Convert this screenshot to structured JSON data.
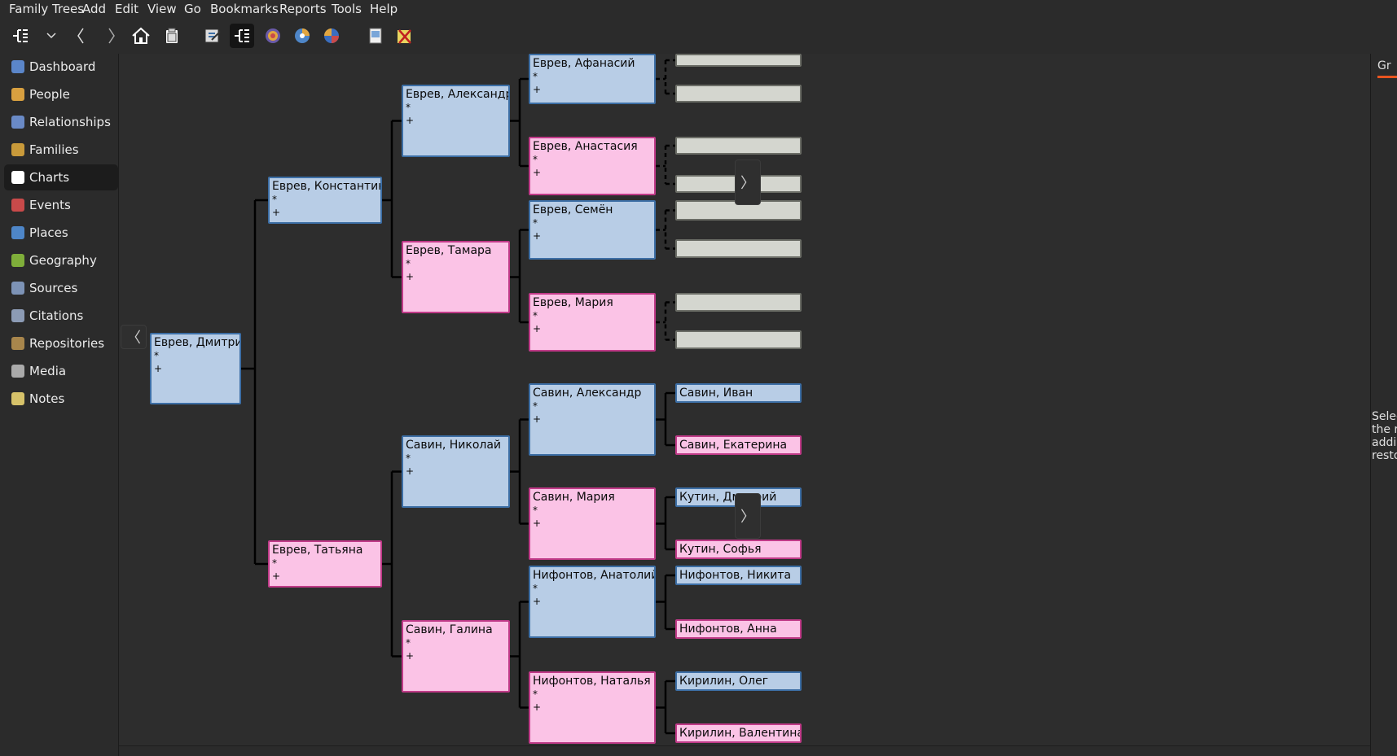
{
  "menu": [
    "Family Trees",
    "Add",
    "Edit",
    "View",
    "Go",
    "Bookmarks",
    "Reports",
    "Tools",
    "Help"
  ],
  "toolbar": {
    "buttons": [
      "pedigree-view-icon",
      "dropdown-chevron-icon",
      "back-icon",
      "forward-icon",
      "home-icon",
      "clipboard-icon",
      "edit-person-icon",
      "pedigree-active-icon",
      "fanchart-icon",
      "fanchart-descendant-icon",
      "fanchart-2way-icon",
      "media-icon",
      "tools-icon"
    ]
  },
  "sidebar": {
    "items": [
      {
        "label": "Dashboard",
        "icon": "dashboard-icon",
        "color": "#5b86c9"
      },
      {
        "label": "People",
        "icon": "people-icon",
        "color": "#d8a040"
      },
      {
        "label": "Relationships",
        "icon": "relationships-icon",
        "color": "#6a8ac6"
      },
      {
        "label": "Families",
        "icon": "families-icon",
        "color": "#c99a3a"
      },
      {
        "label": "Charts",
        "icon": "charts-icon",
        "color": "#ffffff"
      },
      {
        "label": "Events",
        "icon": "events-icon",
        "color": "#c94a4a"
      },
      {
        "label": "Places",
        "icon": "places-icon",
        "color": "#4e86c8"
      },
      {
        "label": "Geography",
        "icon": "geography-icon",
        "color": "#7fae3a"
      },
      {
        "label": "Sources",
        "icon": "sources-icon",
        "color": "#7d93b6"
      },
      {
        "label": "Citations",
        "icon": "citations-icon",
        "color": "#8c9bb5"
      },
      {
        "label": "Repositories",
        "icon": "repositories-icon",
        "color": "#a8864c"
      },
      {
        "label": "Media",
        "icon": "media-icon",
        "color": "#aaaaaa"
      },
      {
        "label": "Notes",
        "icon": "notes-icon",
        "color": "#d6c26a"
      }
    ],
    "active": "Charts"
  },
  "right_pane": {
    "tab": "Gr",
    "text": [
      "Selec",
      "the r",
      "addi",
      "resto"
    ]
  },
  "colors": {
    "male_fill": "#b8cde6",
    "female_fill": "#fbc3e6",
    "unknown_fill": "#d4d6cf",
    "background": "#2d2d2d"
  },
  "pedigree": [
    {
      "id": "p1",
      "name": "Еврев, Дмитрий",
      "gender": "male",
      "birth": "*",
      "death": "+"
    },
    {
      "id": "p2",
      "name": "Еврев, Константин",
      "gender": "male",
      "birth": "*",
      "death": "+"
    },
    {
      "id": "p3",
      "name": "Еврев, Татьяна",
      "gender": "female",
      "birth": "*",
      "death": "+"
    },
    {
      "id": "p4",
      "name": "Еврев, Александр",
      "gender": "male",
      "birth": "*",
      "death": "+"
    },
    {
      "id": "p5",
      "name": "Еврев, Тамара",
      "gender": "female",
      "birth": "*",
      "death": "+"
    },
    {
      "id": "p6",
      "name": "Савин, Николай",
      "gender": "male",
      "birth": "*",
      "death": "+"
    },
    {
      "id": "p7",
      "name": "Савин, Галина",
      "gender": "female",
      "birth": "*",
      "death": "+"
    },
    {
      "id": "p8",
      "name": "Еврев, Афанасий",
      "gender": "male",
      "birth": "*",
      "death": "+"
    },
    {
      "id": "p9",
      "name": "Еврев, Анастасия",
      "gender": "female",
      "birth": "*",
      "death": "+"
    },
    {
      "id": "p10",
      "name": "Еврев, Семён",
      "gender": "male",
      "birth": "*",
      "death": "+"
    },
    {
      "id": "p11",
      "name": "Еврев, Мария",
      "gender": "female",
      "birth": "*",
      "death": "+"
    },
    {
      "id": "p12",
      "name": "Савин, Александр",
      "gender": "male",
      "birth": "*",
      "death": "+"
    },
    {
      "id": "p13",
      "name": "Савин, Мария",
      "gender": "female",
      "birth": "*",
      "death": "+"
    },
    {
      "id": "p14",
      "name": "Нифонтов, Анатолий",
      "gender": "male",
      "birth": "*",
      "death": "+"
    },
    {
      "id": "p15",
      "name": "Нифонтов, Наталья",
      "gender": "female",
      "birth": "*",
      "death": "+"
    },
    {
      "id": "p16",
      "name": "",
      "gender": "unknown"
    },
    {
      "id": "p17",
      "name": "",
      "gender": "unknown"
    },
    {
      "id": "p18",
      "name": "",
      "gender": "unknown"
    },
    {
      "id": "p19",
      "name": "",
      "gender": "unknown"
    },
    {
      "id": "p20",
      "name": "",
      "gender": "unknown"
    },
    {
      "id": "p21",
      "name": "",
      "gender": "unknown"
    },
    {
      "id": "p22",
      "name": "",
      "gender": "unknown"
    },
    {
      "id": "p23",
      "name": "",
      "gender": "unknown"
    },
    {
      "id": "p24",
      "name": "Савин, Иван",
      "gender": "male"
    },
    {
      "id": "p25",
      "name": "Савин, Екатерина",
      "gender": "female"
    },
    {
      "id": "p26",
      "name": "Кутин, Дмитрий",
      "gender": "male"
    },
    {
      "id": "p27",
      "name": "Кутин, Софья",
      "gender": "female"
    },
    {
      "id": "p28",
      "name": "Нифонтов, Никита",
      "gender": "male"
    },
    {
      "id": "p29",
      "name": "Нифонтов, Анна",
      "gender": "female"
    },
    {
      "id": "p30",
      "name": "Кирилин, Олег",
      "gender": "male"
    },
    {
      "id": "p31",
      "name": "Кирилин, Валентина",
      "gender": "female"
    }
  ],
  "nav_buttons": {
    "back": "〈",
    "forward": "〉"
  }
}
